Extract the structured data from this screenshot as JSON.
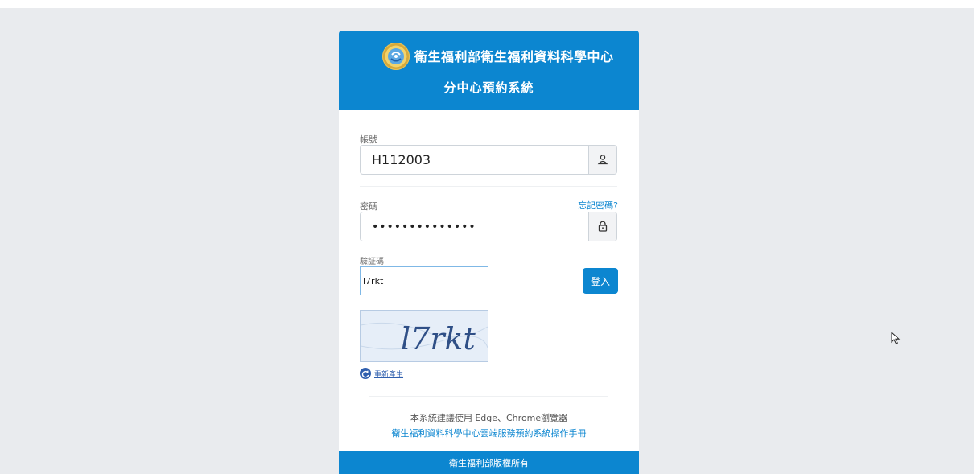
{
  "header": {
    "org_name": "衛生福利部衛生福利資料科學中心",
    "system_name": "分中心預約系統"
  },
  "account": {
    "label": "帳號",
    "value": "H112003"
  },
  "password": {
    "label": "密碼",
    "value": "••••••••••••••",
    "forgot_link": "忘記密碼?"
  },
  "captcha": {
    "label": "驗証碼",
    "value": "l7rkt",
    "image_text": "l7rkt",
    "refresh_label": "重新產生"
  },
  "login_button": "登入",
  "browser_note": "本系統建議使用 Edge、Chrome瀏覽器",
  "manual_link": "衛生福利資料科學中心雲端服務預約系統操作手冊",
  "footer": "衛生福利部版權所有",
  "colors": {
    "primary": "#0c86d0",
    "page_background": "#e9ebee",
    "addon_background": "#f2f3f5"
  }
}
